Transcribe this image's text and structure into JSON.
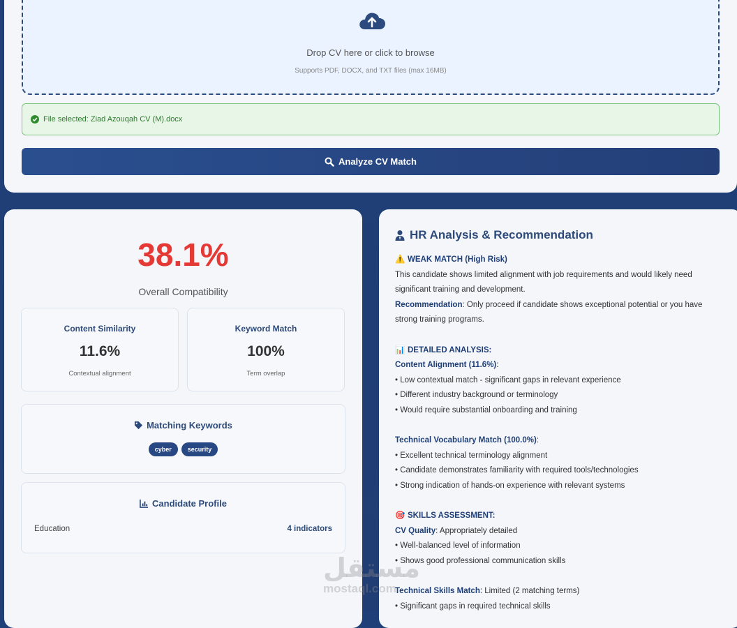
{
  "upload": {
    "drop_text": "Drop CV here or click to browse",
    "drop_sub": "Supports PDF, DOCX, and TXT files (max 16MB)",
    "file_selected": "File selected: Ziad Azouqah CV (M).docx",
    "analyze_label": "Analyze CV Match"
  },
  "results": {
    "score": "38.1%",
    "score_label": "Overall Compatibility",
    "score_color": "#e53935",
    "metrics": [
      {
        "title": "Content Similarity",
        "value": "11.6%",
        "sub": "Contextual alignment"
      },
      {
        "title": "Keyword Match",
        "value": "100%",
        "sub": "Term overlap"
      }
    ],
    "keywords_title": "Matching Keywords",
    "keywords": [
      "cyber",
      "security"
    ],
    "profile_title": "Candidate Profile",
    "profile": {
      "key": "Education",
      "value": "4 indicators"
    }
  },
  "hr": {
    "title": "HR Analysis & Recommendation",
    "weak_icon": "⚠️",
    "weak_title": "WEAK MATCH (High Risk)",
    "weak_line1": "This candidate shows limited alignment with job requirements and would likely need",
    "weak_line2": "significant training and development.",
    "rec_label": "Recommendation",
    "rec_text1": ": Only proceed if candidate shows exceptional potential or you have",
    "rec_text2": "strong training programs.",
    "detailed_icon": "📊",
    "detailed_title": "DETAILED ANALYSIS:",
    "content_label": "Content Alignment (11.6%)",
    "content_colon": ":",
    "content_items": [
      "• Low contextual match - significant gaps in relevant experience",
      "• Different industry background or terminology",
      "• Would require substantial onboarding and training"
    ],
    "tech_label": "Technical Vocabulary Match (100.0%)",
    "tech_colon": ":",
    "tech_items": [
      "• Excellent technical terminology alignment",
      "• Candidate demonstrates familiarity with required tools/technologies",
      "• Strong indication of hands-on experience with relevant systems"
    ],
    "skills_icon": "🎯",
    "skills_title": "SKILLS ASSESSMENT:",
    "cvq_label": "CV Quality",
    "cvq_text": ": Appropriately detailed",
    "cvq_items": [
      "• Well-balanced level of information",
      "• Shows good professional communication skills"
    ],
    "tsm_label": "Technical Skills Match",
    "tsm_text": ": Limited (2 matching terms)",
    "tsm_items": [
      "• Significant gaps in required technical skills"
    ]
  },
  "watermark": {
    "arabic": "مستقل",
    "latin": "mostaql.com"
  }
}
